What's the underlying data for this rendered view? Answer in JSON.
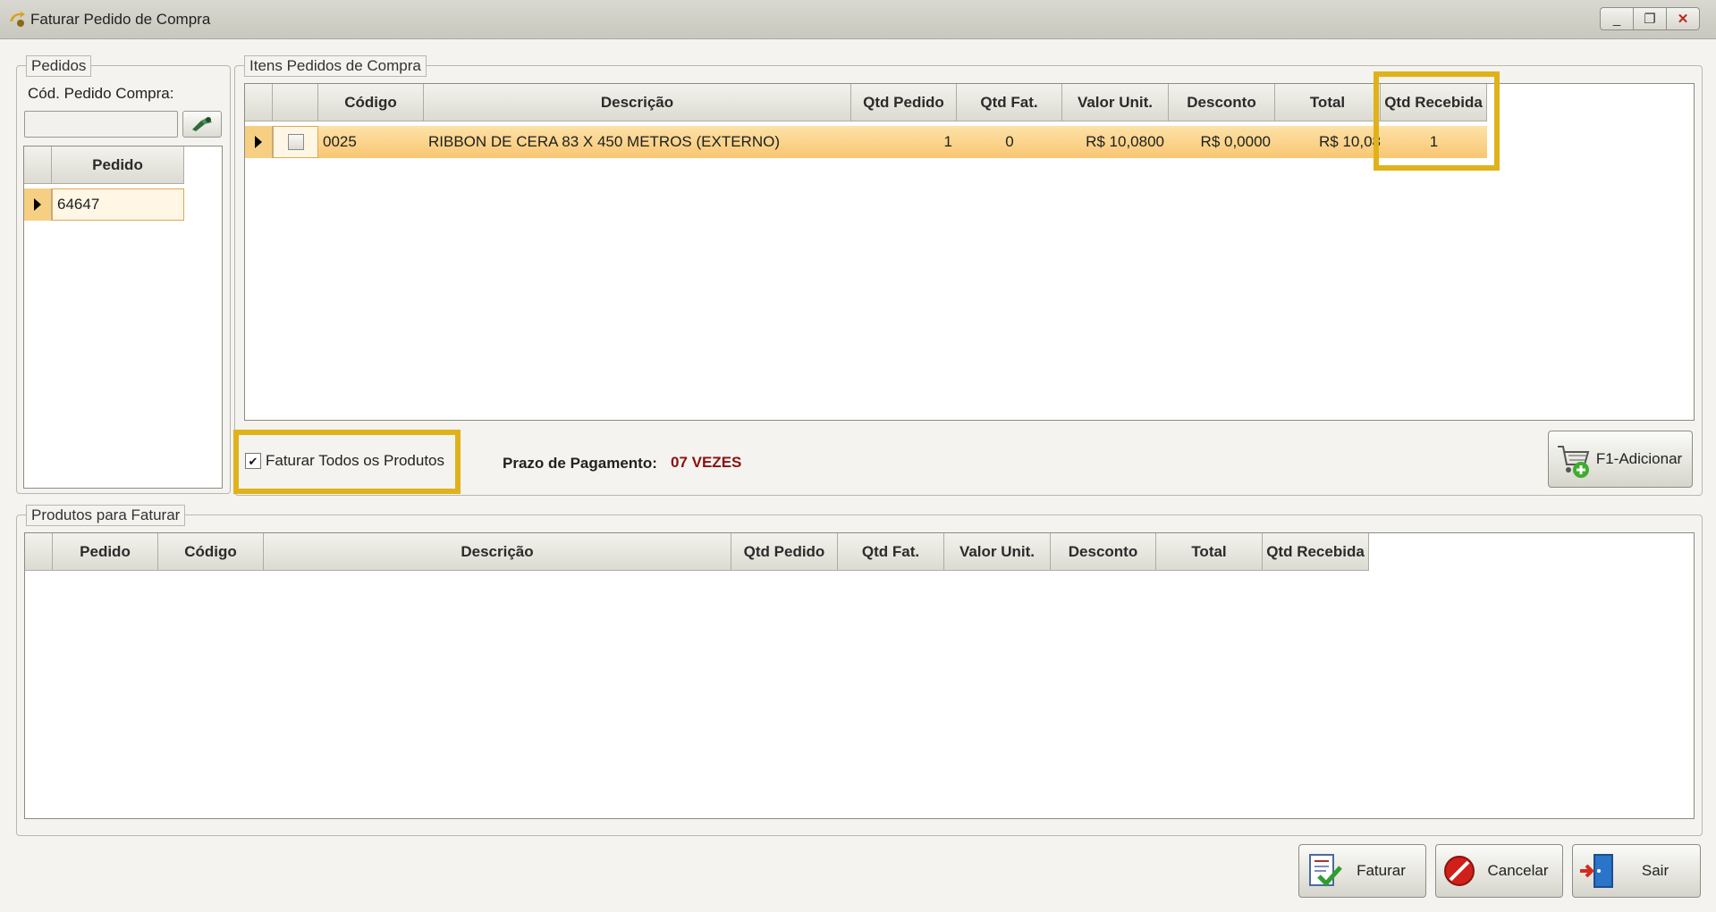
{
  "window": {
    "title": "Faturar Pedido de Compra",
    "controls": {
      "minimize": "_",
      "maximize": "❐",
      "close": "✕"
    }
  },
  "pedidos": {
    "legend": "Pedidos",
    "cod_label": "Cód. Pedido Compra:",
    "cod_value": "",
    "grid": {
      "header": "Pedido",
      "rows": [
        "64647"
      ]
    }
  },
  "itens": {
    "legend": "Itens Pedidos de Compra",
    "columns": [
      "Código",
      "Descrição",
      "Qtd Pedido",
      "Qtd Fat.",
      "Valor Unit.",
      "Desconto",
      "Total",
      "Qtd Recebida"
    ],
    "rows": [
      {
        "codigo": "0025",
        "descricao": "RIBBON DE CERA 83 X 450 METROS (EXTERNO)",
        "qtd_pedido": "1",
        "qtd_fat": "0",
        "valor_unit": "R$ 10,0800",
        "desconto": "R$ 0,0000",
        "total": "R$ 10,08",
        "qtd_recebida": "1"
      }
    ]
  },
  "faturar_todos": {
    "label": "Faturar Todos os Produtos",
    "checked": true,
    "check_glyph": "✔"
  },
  "prazo": {
    "label": "Prazo de Pagamento:",
    "value": "07 VEZES",
    "value_color": "#8b1010"
  },
  "adicionar": {
    "label": "F1-Adicionar"
  },
  "produtos": {
    "legend": "Produtos para Faturar",
    "columns": [
      "Pedido",
      "Código",
      "Descrição",
      "Qtd Pedido",
      "Qtd Fat.",
      "Valor Unit.",
      "Desconto",
      "Total",
      "Qtd Recebida"
    ]
  },
  "buttons": {
    "faturar": "Faturar",
    "cancelar": "Cancelar",
    "sair": "Sair"
  },
  "colors": {
    "highlight": "#e0b21a",
    "selected_row": "#f9c672"
  }
}
